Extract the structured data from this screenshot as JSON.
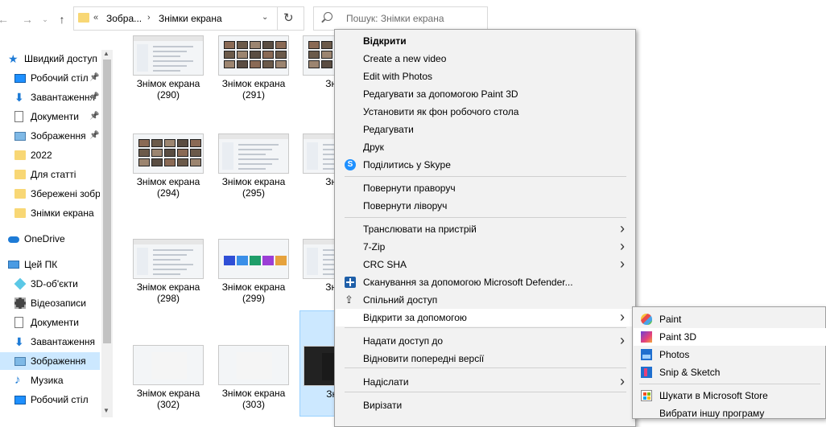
{
  "address": {
    "crumbs": [
      "Зобра...",
      "Знімки екрана"
    ],
    "overflow": "«",
    "separator": "›"
  },
  "search": {
    "placeholder": "Пошук: Знімки екрана"
  },
  "sidebar": {
    "items": [
      {
        "label": "Швидкий доступ",
        "icon": "star-icon",
        "pinned": false
      },
      {
        "label": "Робочий стіл",
        "icon": "desktop-icon",
        "pinned": true
      },
      {
        "label": "Завантаження",
        "icon": "download-icon",
        "pinned": true
      },
      {
        "label": "Документи",
        "icon": "documents-icon",
        "pinned": true
      },
      {
        "label": "Зображення",
        "icon": "pictures-icon",
        "pinned": true
      },
      {
        "label": "2022",
        "icon": "folder-icon",
        "pinned": false
      },
      {
        "label": "Для статті",
        "icon": "folder-icon",
        "pinned": false
      },
      {
        "label": "Збережені зобр",
        "icon": "folder-icon",
        "pinned": false
      },
      {
        "label": "Знімки екрана",
        "icon": "folder-icon",
        "pinned": false
      },
      {
        "label": "OneDrive",
        "icon": "onedrive-icon",
        "pinned": false
      },
      {
        "label": "Цей ПК",
        "icon": "this-pc-icon",
        "pinned": false
      },
      {
        "label": "3D-об'єкти",
        "icon": "3d-objects-icon",
        "pinned": false
      },
      {
        "label": "Відеозаписи",
        "icon": "videos-icon",
        "pinned": false
      },
      {
        "label": "Документи",
        "icon": "documents-icon",
        "pinned": false
      },
      {
        "label": "Завантаження",
        "icon": "download-icon",
        "pinned": false
      },
      {
        "label": "Зображення",
        "icon": "pictures-icon",
        "pinned": false,
        "selected": true
      },
      {
        "label": "Музика",
        "icon": "music-icon",
        "pinned": false
      },
      {
        "label": "Робочий стіл",
        "icon": "desktop-icon",
        "pinned": false
      }
    ]
  },
  "files": [
    {
      "name": "Знімок екрана",
      "num": "(290)"
    },
    {
      "name": "Знімок екрана",
      "num": "(291)"
    },
    {
      "name": "Знімо",
      "num": "("
    },
    {
      "name": "Знімок екрана",
      "num": "(294)"
    },
    {
      "name": "Знімок екрана",
      "num": "(295)"
    },
    {
      "name": "Знімо",
      "num": "("
    },
    {
      "name": "Знімок екрана",
      "num": "(298)"
    },
    {
      "name": "Знімок екрана",
      "num": "(299)"
    },
    {
      "name": "Знімо",
      "num": "("
    },
    {
      "name": "Знімок екрана",
      "num": "(302)"
    },
    {
      "name": "Знімок екрана",
      "num": "(303)"
    },
    {
      "name": "Знімо",
      "num": "("
    }
  ],
  "context_menu": {
    "items": [
      {
        "label": "Відкрити",
        "bold": true
      },
      {
        "label": "Create a new video"
      },
      {
        "label": "Edit with Photos"
      },
      {
        "label": "Редагувати за допомогою Paint 3D"
      },
      {
        "label": "Установити як фон робочого стола"
      },
      {
        "label": "Редагувати"
      },
      {
        "label": "Друк"
      },
      {
        "label": "Поділитись у Skype",
        "icon": "skype-icon"
      },
      {
        "label": "Повернути праворуч"
      },
      {
        "label": "Повернути ліворуч"
      },
      {
        "label": "Транслювати на пристрій",
        "submenu": true
      },
      {
        "label": "7-Zip",
        "submenu": true
      },
      {
        "label": "CRC SHA",
        "submenu": true
      },
      {
        "label": "Сканування за допомогою Microsoft Defender...",
        "icon": "defender-icon"
      },
      {
        "label": "Спільний доступ",
        "icon": "share-icon"
      },
      {
        "label": "Відкрити за допомогою",
        "submenu": true,
        "highlighted": true
      },
      {
        "label": "Надати доступ до",
        "submenu": true
      },
      {
        "label": "Відновити попередні версії"
      },
      {
        "label": "Надіслати",
        "submenu": true
      },
      {
        "label": "Вирізати"
      }
    ]
  },
  "open_with": {
    "items": [
      {
        "label": "Paint",
        "icon": "paint-icon"
      },
      {
        "label": "Paint 3D",
        "icon": "paint-3d-icon",
        "highlighted": true
      },
      {
        "label": "Photos",
        "icon": "photos-icon"
      },
      {
        "label": "Snip & Sketch",
        "icon": "snip-sketch-icon"
      },
      {
        "label": "Шукати в Microsoft Store",
        "icon": "microsoft-store-icon"
      },
      {
        "label": "Вибрати іншу програму"
      }
    ]
  },
  "colors": {
    "selection": "#cce8ff",
    "menu_bg": "#f2f2f2",
    "accent": "#1e7bd6"
  }
}
